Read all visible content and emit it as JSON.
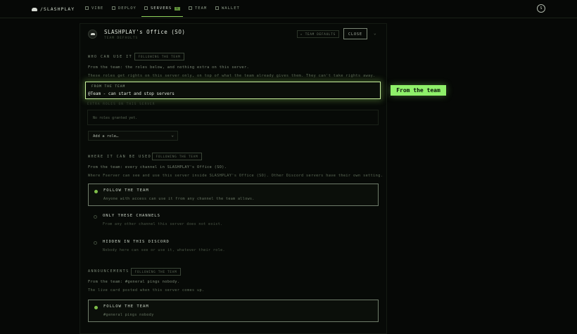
{
  "nav": {
    "brand": "/SLASHPLAY",
    "tabs": [
      {
        "label": "VIBE",
        "icon": "vibe-icon"
      },
      {
        "label": "DEPLOY",
        "icon": "deploy-icon"
      },
      {
        "label": "SERVERS",
        "icon": "servers-icon",
        "badge": "1",
        "active": true
      },
      {
        "label": "TEAM",
        "icon": "team-icon"
      },
      {
        "label": "WALLET",
        "icon": "wallet-icon"
      }
    ],
    "user_initial": "S"
  },
  "server": {
    "title": "SLASHPLAY's Office (SO)",
    "subtitle": "TEAM DEFAULTS",
    "settings_label": "▸ TEAM DEFAULTS",
    "close_label": "CLOSE"
  },
  "who": {
    "label": "WHO CAN USE IT",
    "pill": "FOLLOWING THE TEAM",
    "line1": "From the team: the roles below, and nothing extra on this server.",
    "line2": "These roles get rights on this server only, on top of what the team already gives them. They can't take rights away.",
    "from_team_label": "FROM THE TEAM",
    "from_team_value": "@Team - can start and stop servers",
    "callout": "From the team",
    "extra_label": "EXTRA ROLES ON THIS SERVER",
    "empty": "No roles granted yet.",
    "add_role": "Add a role…"
  },
  "where": {
    "label": "WHERE IT CAN BE USED",
    "pill": "FOLLOWING THE TEAM",
    "line1": "From the team: every channel in SLASHPLAY's Office (SO).",
    "line2": "Where Fserver can see and use this server inside SLASHPLAY's Office (SO). Other Discord servers have their own setting.",
    "options": [
      {
        "title": "FOLLOW THE TEAM",
        "desc": "Anyone with access can use it from any channel the team allows."
      },
      {
        "title": "ONLY THESE CHANNELS",
        "desc": "From any other channel this server does not exist."
      },
      {
        "title": "HIDDEN IN THIS DISCORD",
        "desc": "Nobody here can see or use it, whatever their role."
      }
    ]
  },
  "announce": {
    "label": "ANNOUNCEMENTS",
    "pill": "FOLLOWING THE TEAM",
    "line1": "From the team: #general pings nobody.",
    "line2": "The live card posted when this server comes up.",
    "option_title": "FOLLOW THE TEAM",
    "option_desc": "#general pings nobody"
  },
  "colors": {
    "accent": "#8fd35c",
    "callout": "#8ff06a",
    "background": "#060806"
  }
}
